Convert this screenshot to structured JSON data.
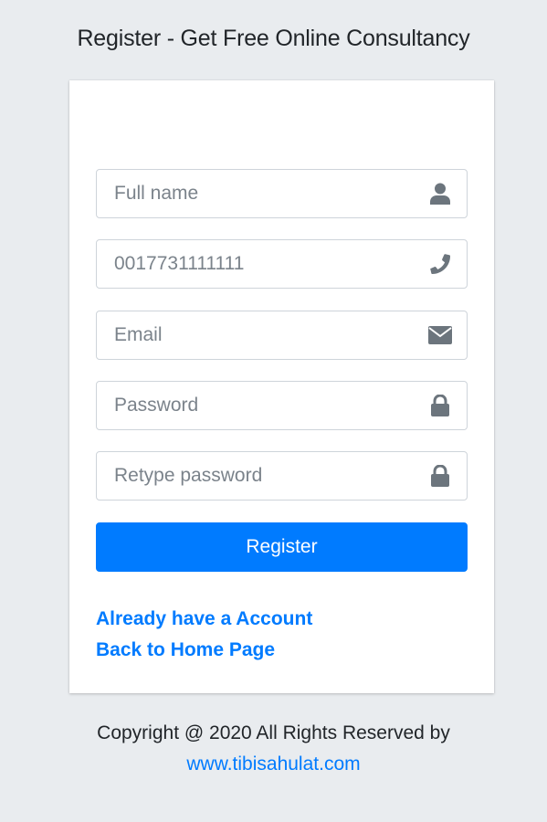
{
  "page": {
    "title": "Register - Get Free Online Consultancy"
  },
  "form": {
    "fields": [
      {
        "name": "full-name",
        "placeholder": "Full name",
        "value": "",
        "icon": "user-icon"
      },
      {
        "name": "phone",
        "placeholder": "0017731111111",
        "value": "",
        "icon": "phone-icon"
      },
      {
        "name": "email",
        "placeholder": "Email",
        "value": "",
        "icon": "envelope-icon"
      },
      {
        "name": "password",
        "placeholder": "Password",
        "value": "",
        "icon": "lock-icon"
      },
      {
        "name": "retype-password",
        "placeholder": "Retype password",
        "value": "",
        "icon": "lock-icon"
      }
    ],
    "register_label": "Register",
    "links": {
      "login": "Already have a Account",
      "home": "Back to Home Page"
    }
  },
  "footer": {
    "copyright": "Copyright @ 2020 All Rights Reserved by",
    "site_link": "www.tibisahulat.com"
  },
  "colors": {
    "background": "#e9ecef",
    "card": "#ffffff",
    "primary": "#007bff",
    "icon": "#6c757d",
    "text": "#212529"
  }
}
